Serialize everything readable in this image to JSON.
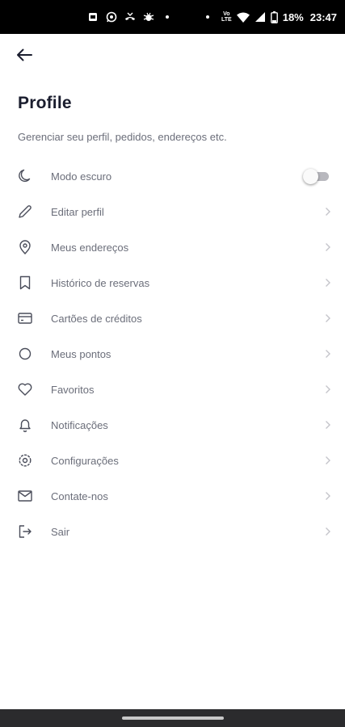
{
  "status_bar": {
    "battery_percent": "18%",
    "time": "23:47",
    "volte_label": "Vo\nLTE",
    "icons": [
      "sim-card-icon",
      "whatsapp-icon",
      "missed-call-icon",
      "bug-icon",
      "dot-icon",
      "dot-icon",
      "volte-icon",
      "wifi-icon",
      "signal-icon",
      "battery-icon"
    ]
  },
  "header": {
    "back_icon": "arrow-left-icon",
    "title": "Profile",
    "subtitle": "Gerenciar seu perfil, pedidos, endereços etc."
  },
  "menu": {
    "dark_mode": {
      "label": "Modo escuro",
      "icon": "moon-icon",
      "enabled": false
    },
    "items": [
      {
        "label": "Editar perfil",
        "icon": "pencil-icon"
      },
      {
        "label": "Meus endereços",
        "icon": "location-pin-icon"
      },
      {
        "label": "Histórico de reservas",
        "icon": "bookmark-icon"
      },
      {
        "label": "Cartões de créditos",
        "icon": "credit-card-icon"
      },
      {
        "label": "Meus pontos",
        "icon": "circle-icon"
      },
      {
        "label": "Favoritos",
        "icon": "heart-icon"
      },
      {
        "label": "Notificações",
        "icon": "bell-icon"
      },
      {
        "label": "Configurações",
        "icon": "settings-icon"
      },
      {
        "label": "Contate-nos",
        "icon": "mail-icon"
      },
      {
        "label": "Sair",
        "icon": "logout-icon"
      }
    ]
  },
  "colors": {
    "title": "#1a1d2e",
    "label": "#6b6e7a",
    "chevron": "#c4c4ca",
    "status_bar": "#000000",
    "nav_bar": "#2b2b2d"
  }
}
